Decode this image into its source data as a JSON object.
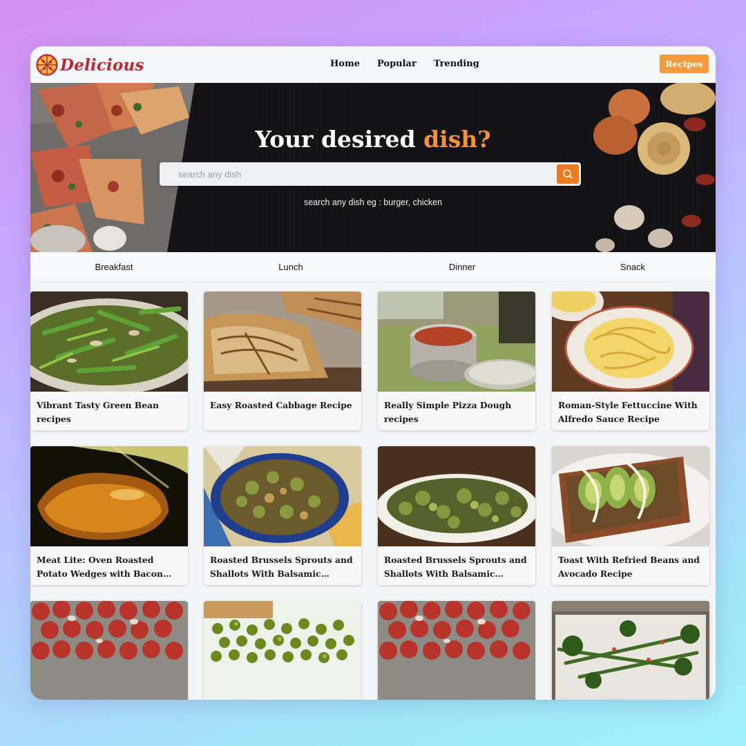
{
  "brand": {
    "name": "Delicious",
    "logo_icon": "pizza-icon"
  },
  "nav": {
    "links": [
      "Home",
      "Popular",
      "Trending"
    ],
    "cta_label": "Recipes"
  },
  "hero": {
    "title_main": "Your desired ",
    "title_accent": "dish?",
    "search_placeholder": "search any dish",
    "search_icon": "search-icon",
    "hint": "search any dish eg : burger, chicken"
  },
  "categories": [
    "Breakfast",
    "Lunch",
    "Dinner",
    "Snack"
  ],
  "recipes": [
    {
      "title": "Vibrant Tasty Green Bean recipes",
      "image": "green-beans"
    },
    {
      "title": "Easy Roasted Cabbage Recipe",
      "image": "roasted-cabbage"
    },
    {
      "title": "Really Simple Pizza Dough recipes",
      "image": "pizza-dough"
    },
    {
      "title": "Roman-Style Fettuccine With Alfredo Sauce Recipe",
      "image": "fettuccine"
    },
    {
      "title": "Meat Lite: Oven Roasted Potato Wedges with Bacon Grease Recipe",
      "image": "bacon-grease"
    },
    {
      "title": "Roasted Brussels Sprouts and Shallots With Balsamic Vinegar Recipe",
      "image": "brussels-sprouts-plate"
    },
    {
      "title": "Roasted Brussels Sprouts and Shallots With Balsamic Vinegar Recipe",
      "image": "brussels-sprouts-dish"
    },
    {
      "title": "Toast With Refried Beans and Avocado Recipe",
      "image": "avocado-toast"
    },
    {
      "title": "",
      "image": "roasted-tomatoes"
    },
    {
      "title": "",
      "image": "green-peas"
    },
    {
      "title": "",
      "image": "roasted-tomatoes"
    },
    {
      "title": "",
      "image": "broccolini"
    }
  ],
  "colors": {
    "accent": "#f5923a",
    "search_button": "#f0791f",
    "brand": "#c0262d",
    "hero_bg": "#141316"
  }
}
